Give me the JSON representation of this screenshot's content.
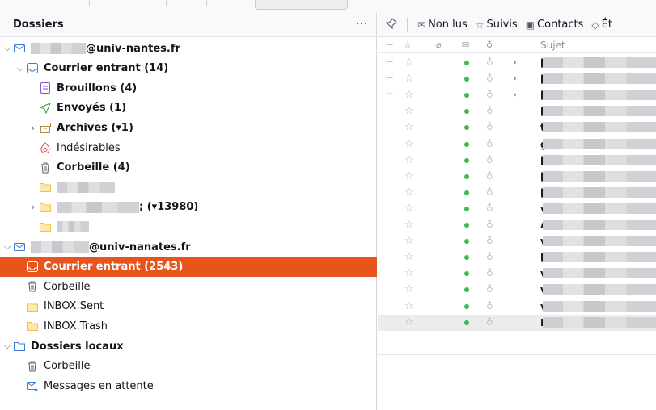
{
  "colors": {
    "accent": "#e9541c",
    "unread_dot": "#3fb950",
    "folder_yellow": "#f3c147",
    "account_blue": "#3d7ad6"
  },
  "folder_pane": {
    "title": "Dossiers",
    "menu": "···",
    "tree": [
      {
        "label": "@univ-nantes.fr",
        "icon": "account-icon",
        "twisty": "⌵",
        "bold": true,
        "redacted": true
      },
      {
        "label": "Courrier entrant (14)",
        "icon": "inbox-icon",
        "twisty": "⌵",
        "bold": true
      },
      {
        "label": "Brouillons (4)",
        "icon": "drafts-icon",
        "bold": true
      },
      {
        "label": "Envoyés (1)",
        "icon": "sent-icon",
        "bold": true
      },
      {
        "label": "Archives (▾1)",
        "icon": "archive-icon",
        "twisty": "›",
        "bold": true
      },
      {
        "label": "Indésirables",
        "icon": "junk-icon"
      },
      {
        "label": "Corbeille (4)",
        "icon": "trash-icon",
        "bold": true
      },
      {
        "label": "",
        "icon": "folder-icon",
        "redacted": true
      },
      {
        "label": "; (▾13980)",
        "icon": "folder-icon",
        "twisty": "›",
        "bold": true,
        "redacted": true
      },
      {
        "label": "",
        "icon": "folder-icon",
        "redacted": true
      },
      {
        "label": "@univ-nanates.fr",
        "icon": "account-icon",
        "twisty": "⌵",
        "bold": true,
        "redacted": true
      },
      {
        "label": "Courrier entrant (2543)",
        "icon": "inbox-icon",
        "bold": true,
        "selected": true
      },
      {
        "label": "Corbeille",
        "icon": "trash-icon"
      },
      {
        "label": "INBOX.Sent",
        "icon": "folder-icon"
      },
      {
        "label": "INBOX.Trash",
        "icon": "folder-icon"
      },
      {
        "label": "Dossiers locaux",
        "icon": "local-folders-icon",
        "twisty": "⌵",
        "bold": true
      },
      {
        "label": "Corbeille",
        "icon": "trash-icon"
      },
      {
        "label": "Messages en attente",
        "icon": "outbox-icon"
      }
    ]
  },
  "quick_filter": {
    "pin_icon": "pin-icon",
    "unread": "Non lus",
    "starred": "Suivis",
    "contacts": "Contacts",
    "tags": "Ét"
  },
  "columns": {
    "subject": "Sujet"
  },
  "messages": [
    {
      "thread": true,
      "chevron": true,
      "first": "["
    },
    {
      "thread": true,
      "chevron": true,
      "first": "["
    },
    {
      "thread": true,
      "chevron": true,
      "first": "["
    },
    {
      "first": "["
    },
    {
      "first": "t"
    },
    {
      "first": "g"
    },
    {
      "first": "["
    },
    {
      "first": "["
    },
    {
      "first": "["
    },
    {
      "first": "v"
    },
    {
      "first": "A"
    },
    {
      "first": "v"
    },
    {
      "first": "["
    },
    {
      "first": "v"
    },
    {
      "first": "v"
    },
    {
      "first": "v"
    },
    {
      "first": "R",
      "selected": true
    }
  ]
}
